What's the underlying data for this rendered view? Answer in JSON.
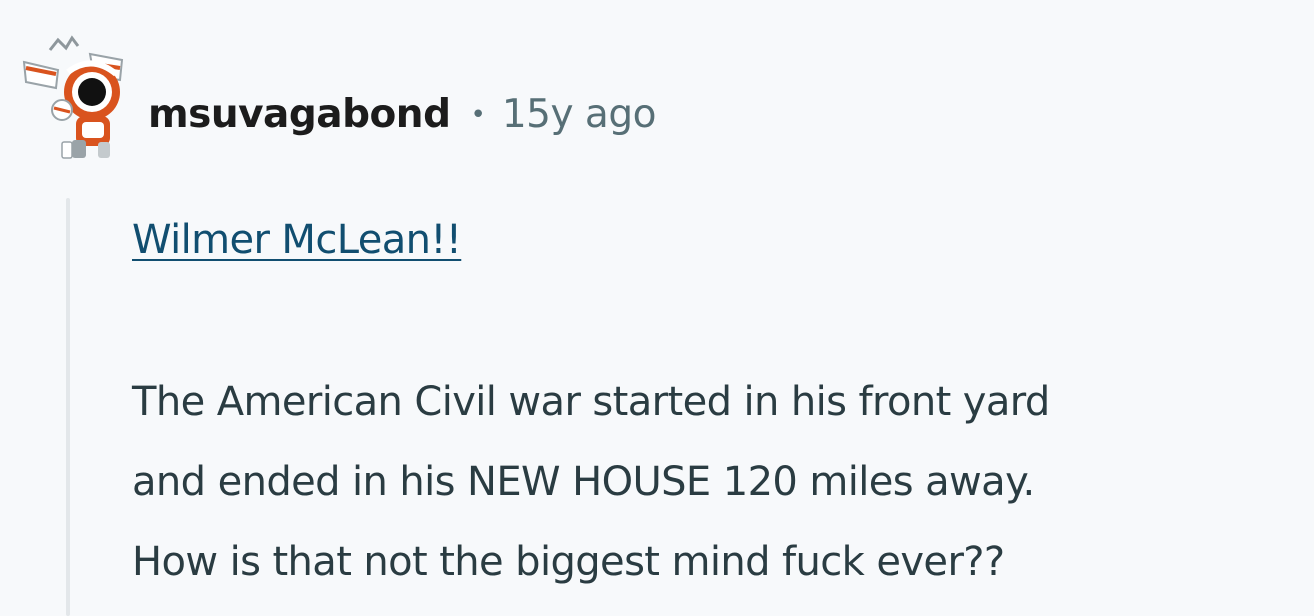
{
  "comment": {
    "username": "msuvagabond",
    "separator": "•",
    "timestamp": "15y ago",
    "link_text": "Wilmer McLean!!",
    "body_lines": [
      "The American Civil war started in his front yard",
      "and ended in his NEW HOUSE 120 miles away.",
      "How is that not the biggest mind fuck ever??"
    ]
  },
  "avatar": {
    "icon": "snoo-avatar-icon",
    "colors": {
      "orange": "#d9531e",
      "white": "#ffffff",
      "gray": "#9aa3a8",
      "black": "#111111"
    }
  },
  "colors": {
    "background": "#f7f9fb",
    "username": "#1c1c1c",
    "meta": "#576f76",
    "link": "#114e70",
    "body_text": "#2a3c42",
    "thread_line": "#e3e7ea"
  }
}
